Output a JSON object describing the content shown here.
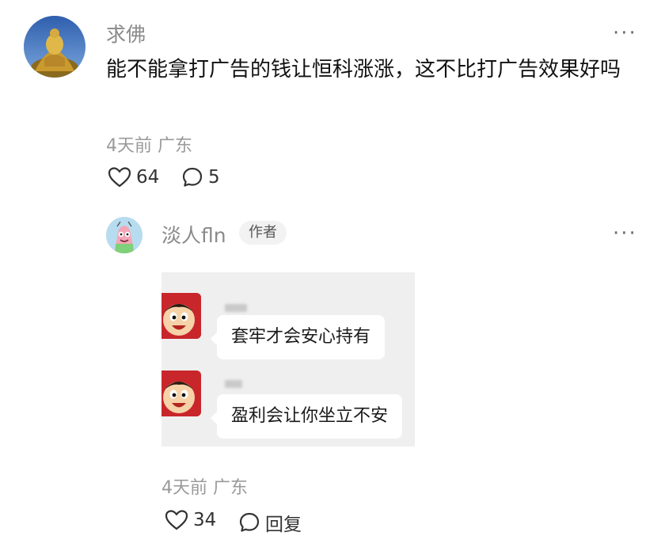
{
  "comment": {
    "username": "求佛",
    "more_label": "···",
    "text": "能不能拿打广告的钱让恒科涨涨，这不比打广告效果好吗",
    "time_location": "4天前 广东",
    "likes": "64",
    "replies": "5"
  },
  "reply": {
    "username": "淡人fln",
    "author_badge": "作者",
    "more_label": "···",
    "image": {
      "messages": [
        {
          "text": "套牢才会安心持有"
        },
        {
          "text": "盈利会让你坐立不安"
        }
      ]
    },
    "time_location": "4天前 广东",
    "likes": "34",
    "reply_label": "回复"
  },
  "icons": [
    "heart-icon",
    "comment-bubble-icon",
    "more-icon"
  ],
  "colors": {
    "meta_gray": "#9a9a9a",
    "username_gray": "#8a8a8a",
    "image_bg": "#efefef",
    "avatar_red": "#c8262b"
  }
}
